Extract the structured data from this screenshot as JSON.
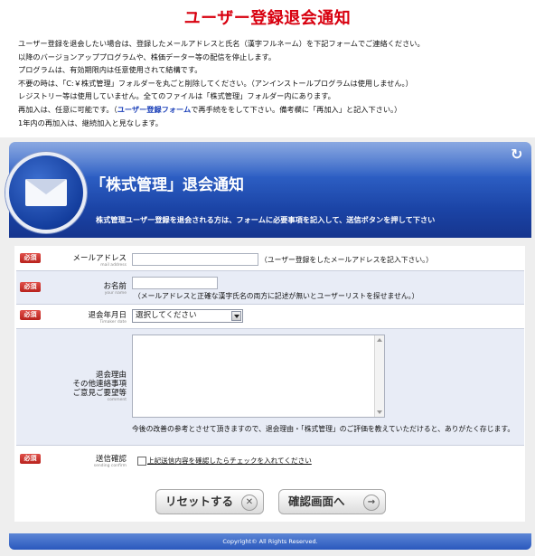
{
  "page_title": "ユーザー登録退会通知",
  "notice_lines": [
    "ユーザー登録を退会したい場合は、登録したメールアドレスと氏名（漢字フルネーム）を下記フォームでご連絡ください。",
    "以降のバージョンアッププログラムや、株価データー等の配信を停止します。",
    "プログラムは、有効期限内は任意使用されて結構です。",
    "不要の時は、「C:￥株式管理」フォルダーを丸ごと削除してください。（アンインストールプログラムは使用しません。）",
    "レジストリー等は使用していません。全てのファイルは「株式管理」フォルダー内にあります。"
  ],
  "rejoin_line": {
    "before": "再加入は、任意に可能です。（",
    "link": "ユーザー登録フォーム",
    "after": "で再手続ををして下さい。備考欄に「再加入」と記入下さい。）"
  },
  "notice_last": "1年内の再加入は、継続加入と見なします。",
  "banner": {
    "title": "「株式管理」退会通知",
    "subtitle": "株式管理ユーザー登録を退会される方は、フォームに必要事項を記入して、送信ボタンを押して下さい"
  },
  "required_badge": "必須",
  "fields": {
    "email": {
      "label": "メールアドレス",
      "label_en": "mail address",
      "value": "",
      "hint": "（ユーザー登録をしたメールアドレスを記入下さい。）"
    },
    "name": {
      "label": "お名前",
      "label_en": "your name",
      "value": "",
      "hint": "（メールアドレスと正確な漢字氏名の両方に記述が無いとユーザーリストを探せません。）"
    },
    "date": {
      "label": "退会年月日",
      "label_en": "Timaker date",
      "selected": "選択してください"
    },
    "comment": {
      "label1": "退会理由",
      "label2": "その他連絡事項",
      "label3": "ご意見ご要望等",
      "label_en": "comment",
      "hint": "今後の改善の参考とさせて頂きますので、退会理由・「株式管理」のご評価を教えていただけると、ありがたく存じます。"
    },
    "confirm": {
      "label": "送信確認",
      "label_en": "sending confirm",
      "checkbox_label": "上記送信内容を確認したらチェックを入れてください"
    }
  },
  "buttons": {
    "reset": "リセットする",
    "confirm": "確認画面へ"
  },
  "icons": {
    "refresh": "refresh-icon",
    "mail": "envelope-icon",
    "reset": "close-icon",
    "next": "arrow-right-icon"
  },
  "footer": "Copyright© All Rights Reserved.",
  "colors": {
    "title": "#d8000f",
    "banner": "#1b44a6",
    "required": "#c0302b",
    "link": "#1a3fb8"
  }
}
